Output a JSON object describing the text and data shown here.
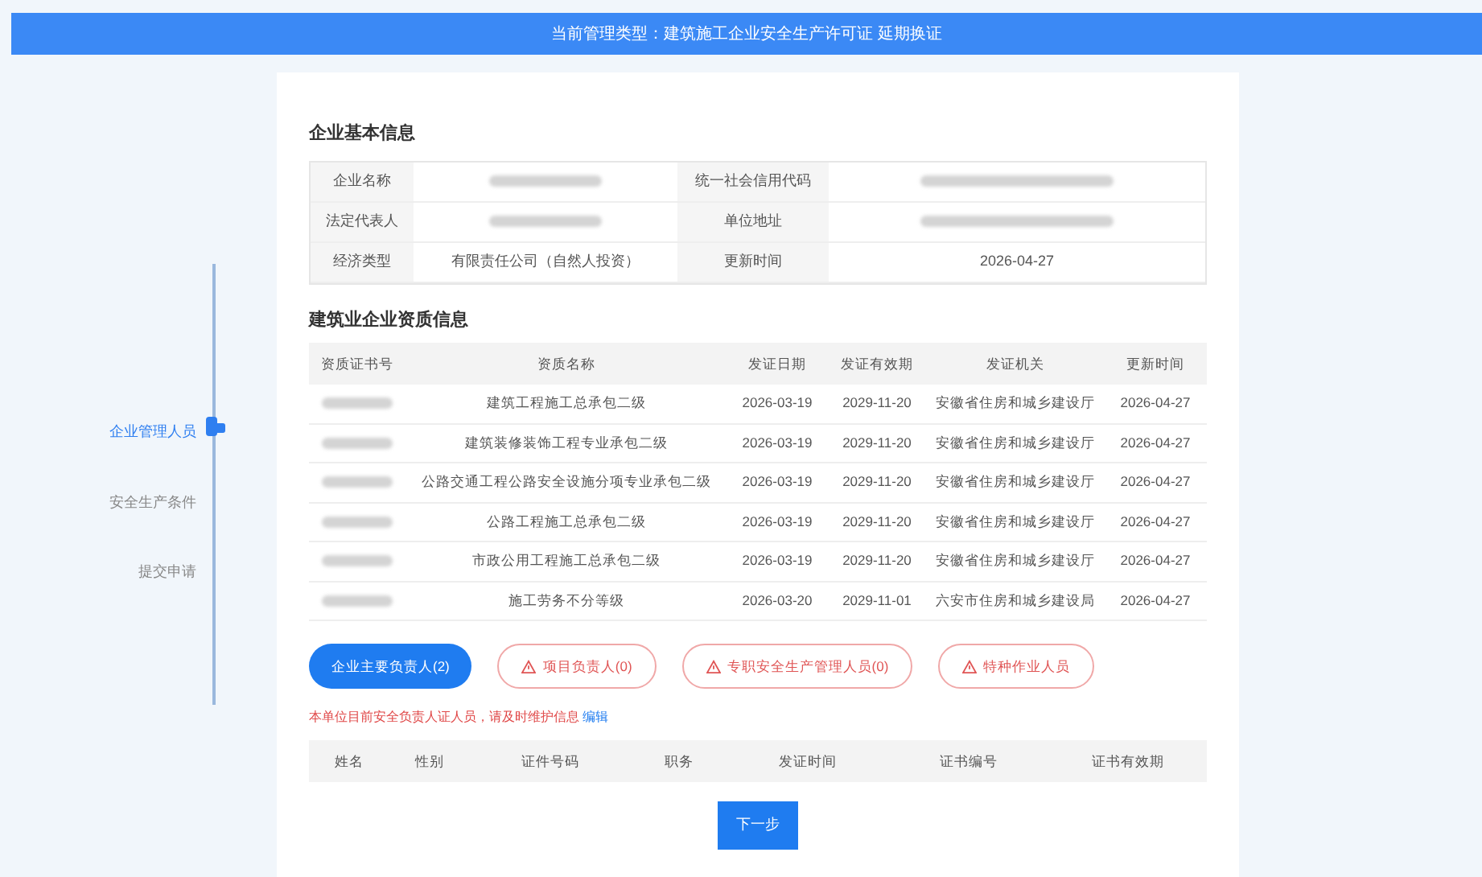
{
  "header": {
    "title": "当前管理类型：建筑施工企业安全生产许可证 延期换证"
  },
  "steps": [
    {
      "label": "企业管理人员",
      "selected": true
    },
    {
      "label": "安全生产条件",
      "selected": false
    },
    {
      "label": "提交申请",
      "selected": false
    }
  ],
  "basic_info": {
    "title": "企业基本信息",
    "rows": [
      {
        "label_1": "企业名称",
        "value_1_redacted": true,
        "label_2": "统一社会信用代码",
        "value_2_redacted": true
      },
      {
        "label_1": "法定代表人",
        "value_1_redacted": true,
        "label_2": "单位地址",
        "value_2_redacted": true
      },
      {
        "label_1": "经济类型",
        "value_1": "有限责任公司（自然人投资）",
        "label_2": "更新时间",
        "value_2": "2026-04-27"
      }
    ]
  },
  "qualifications": {
    "title": "建筑业企业资质信息",
    "columns": [
      "资质证书号",
      "资质名称",
      "发证日期",
      "发证有效期",
      "发证机关",
      "更新时间"
    ],
    "rows": [
      {
        "name": "建筑工程施工总承包二级",
        "issued": "2026-03-19",
        "valid": "2029-11-20",
        "authority": "安徽省住房和城乡建设厅",
        "updated": "2026-04-27"
      },
      {
        "name": "建筑装修装饰工程专业承包二级",
        "issued": "2026-03-19",
        "valid": "2029-11-20",
        "authority": "安徽省住房和城乡建设厅",
        "updated": "2026-04-27"
      },
      {
        "name": "公路交通工程公路安全设施分项专业承包二级",
        "issued": "2026-03-19",
        "valid": "2029-11-20",
        "authority": "安徽省住房和城乡建设厅",
        "updated": "2026-04-27"
      },
      {
        "name": "公路工程施工总承包二级",
        "issued": "2026-03-19",
        "valid": "2029-11-20",
        "authority": "安徽省住房和城乡建设厅",
        "updated": "2026-04-27"
      },
      {
        "name": "市政公用工程施工总承包二级",
        "issued": "2026-03-19",
        "valid": "2029-11-20",
        "authority": "安徽省住房和城乡建设厅",
        "updated": "2026-04-27"
      },
      {
        "name": "施工劳务不分等级",
        "issued": "2026-03-20",
        "valid": "2029-11-01",
        "authority": "六安市住房和城乡建设局",
        "updated": "2026-04-27"
      }
    ]
  },
  "personnel_tabs": [
    {
      "label": "企业主要负责人(2)",
      "selected": true,
      "warning": false
    },
    {
      "label": "项目负责人(0)",
      "selected": false,
      "warning": true
    },
    {
      "label": "专职安全生产管理人员(0)",
      "selected": false,
      "warning": true
    },
    {
      "label": "特种作业人员",
      "selected": false,
      "warning": true
    }
  ],
  "notice": {
    "text": "本单位目前安全负责人证人员，请及时维护信息",
    "link": "编辑"
  },
  "personnel_table": {
    "columns": [
      "姓名",
      "性别",
      "证件号码",
      "职务",
      "发证时间",
      "证书编号",
      "证书有效期"
    ]
  },
  "next_button": "下一步"
}
